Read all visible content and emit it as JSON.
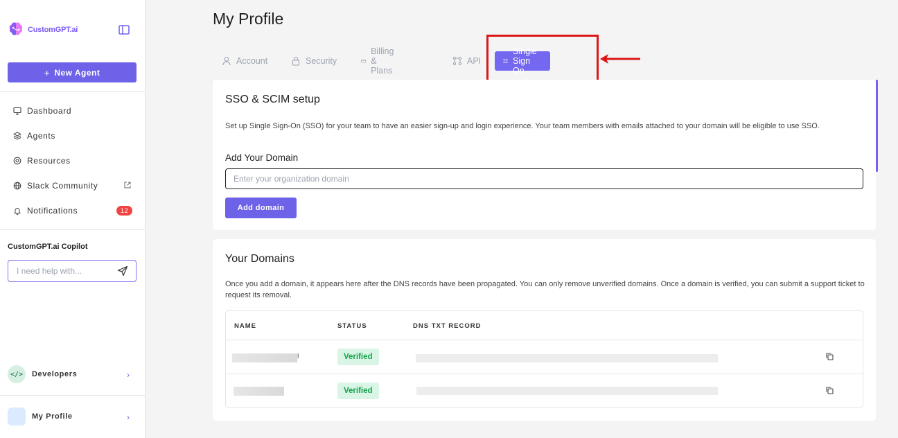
{
  "brand": {
    "name": "CustomGPT.ai",
    "accent": "#6d62e8"
  },
  "sidebar": {
    "new_agent_label": "New Agent",
    "items": [
      {
        "label": "Dashboard",
        "icon": "monitor-icon"
      },
      {
        "label": "Agents",
        "icon": "layers-icon"
      },
      {
        "label": "Resources",
        "icon": "lifebuoy-icon"
      },
      {
        "label": "Slack Community",
        "icon": "globe-icon"
      },
      {
        "label": "Notifications",
        "icon": "bell-icon",
        "badge": "12"
      }
    ],
    "copilot": {
      "title": "CustomGPT.ai Copilot",
      "placeholder": "I need help with..."
    },
    "developers_label": "Developers",
    "profile_label": "My Profile"
  },
  "page": {
    "title": "My Profile",
    "tabs": [
      {
        "label": "Account",
        "icon": "user-icon"
      },
      {
        "label": "Security",
        "icon": "lock-icon"
      },
      {
        "label": "Billing & Plans",
        "icon": "credit-card-icon"
      },
      {
        "label": "API",
        "icon": "api-icon"
      },
      {
        "label": "Single Sign On",
        "icon": "sso-icon",
        "active": true
      }
    ]
  },
  "sso": {
    "title": "SSO & SCIM setup",
    "description": "Set up Single Sign-On (SSO) for your team to have an easier sign-up and login experience. Your team members with emails attached to your domain will be eligible to use SSO.",
    "add_domain_label": "Add Your Domain",
    "domain_placeholder": "Enter your organization domain",
    "add_domain_button": "Add domain"
  },
  "domains": {
    "title": "Your Domains",
    "description": "Once you add a domain, it appears here after the DNS records have been propagated. You can only remove unverified domains. Once a domain is verified, you can submit a support ticket to request its removal.",
    "columns": [
      "NAME",
      "STATUS",
      "DNS TXT RECORD"
    ],
    "rows": [
      {
        "name_suffix": "i",
        "status": "Verified"
      },
      {
        "name_suffix": "",
        "status": "Verified"
      }
    ]
  },
  "colors": {
    "verified_bg": "#d9f5e6",
    "verified_text": "#16a34a",
    "highlight": "#dc1616",
    "badge": "#ef4444"
  }
}
